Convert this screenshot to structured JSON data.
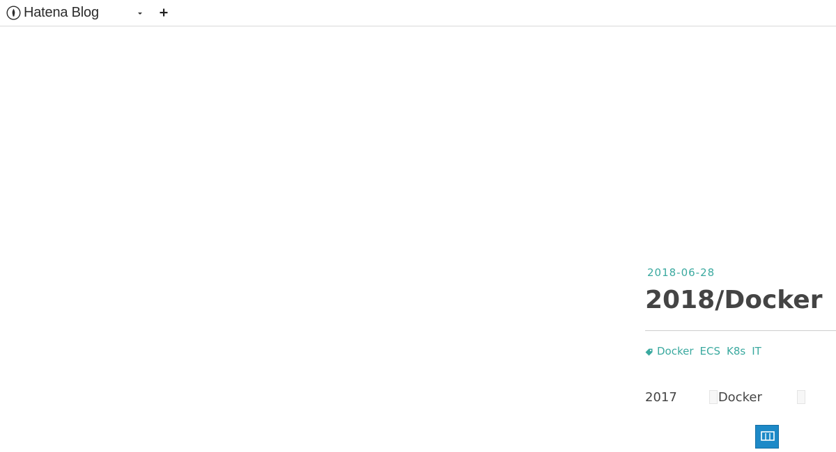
{
  "header": {
    "brand": "Hatena Blog"
  },
  "entry": {
    "date": "2018-06-28",
    "title": "2018/Docker",
    "tags": [
      "Docker",
      "ECS",
      "K8s",
      "IT"
    ],
    "body": {
      "year": "2017",
      "word": "Docker"
    }
  },
  "colors": {
    "accent": "#3aa99f",
    "title": "#444444",
    "border": "#d9d9d9",
    "thumb": "#1d89c7"
  },
  "icons": [
    "hatena-logo-icon",
    "caret-down-icon",
    "plus-icon",
    "tag-icon",
    "docker-image"
  ]
}
